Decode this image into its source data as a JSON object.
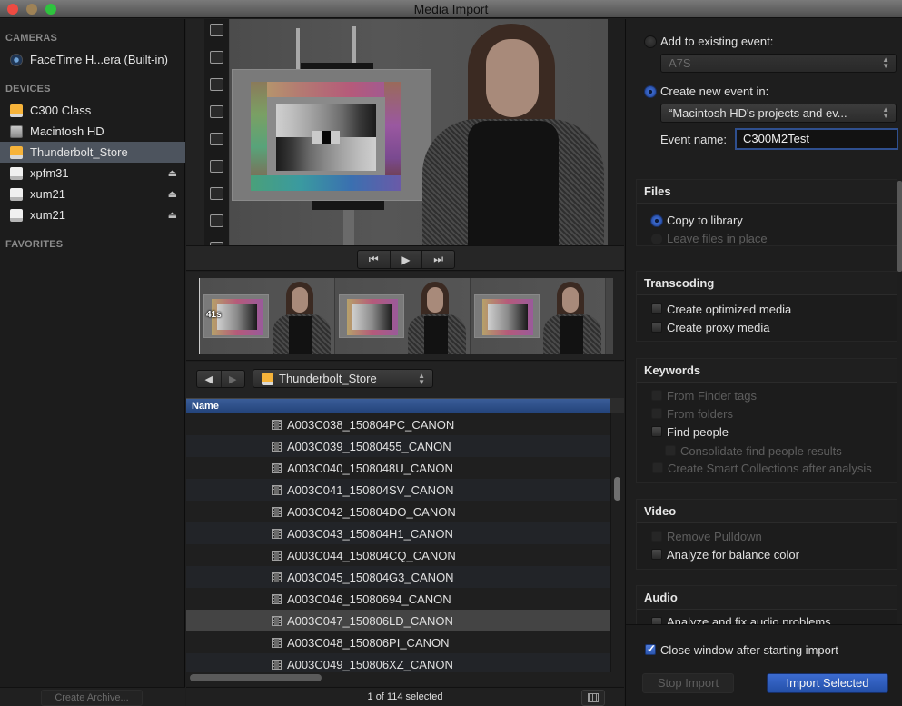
{
  "window": {
    "title": "Media Import"
  },
  "sidebar": {
    "sections": {
      "cameras": "CAMERAS",
      "devices": "DEVICES",
      "favorites": "FAVORITES"
    },
    "cameras": [
      {
        "label": "FaceTime H...era (Built-in)",
        "icon": "camera-icon"
      }
    ],
    "devices": [
      {
        "label": "C300 Class",
        "icon": "external-drive-orange-icon",
        "eject": false,
        "selected": false
      },
      {
        "label": "Macintosh HD",
        "icon": "internal-drive-icon",
        "eject": false,
        "selected": false
      },
      {
        "label": "Thunderbolt_Store",
        "icon": "external-drive-orange-icon",
        "eject": false,
        "selected": true
      },
      {
        "label": "xpfm31",
        "icon": "removable-drive-icon",
        "eject": true,
        "selected": false
      },
      {
        "label": "xum21",
        "icon": "removable-drive-icon",
        "eject": true,
        "selected": false
      },
      {
        "label": "xum21",
        "icon": "removable-drive-icon",
        "eject": true,
        "selected": false
      }
    ],
    "eject_glyph": "⏏",
    "create_archive_label": "Create Archive..."
  },
  "viewer": {
    "transport": {
      "prev_glyph": "⏮",
      "play_glyph": "▶",
      "next_glyph": "⏭"
    },
    "filmstrip_duration": "41s"
  },
  "browser": {
    "back_glyph": "◀",
    "forward_glyph": "▶",
    "location": "Thunderbolt_Store",
    "column_header": "Name",
    "files": [
      {
        "name": "A003C038_150804PC_CANON",
        "selected": false
      },
      {
        "name": "A003C039_15080455_CANON",
        "selected": false
      },
      {
        "name": "A003C040_1508048U_CANON",
        "selected": false
      },
      {
        "name": "A003C041_150804SV_CANON",
        "selected": false
      },
      {
        "name": "A003C042_150804DO_CANON",
        "selected": false
      },
      {
        "name": "A003C043_150804H1_CANON",
        "selected": false
      },
      {
        "name": "A003C044_150804CQ_CANON",
        "selected": false
      },
      {
        "name": "A003C045_150804G3_CANON",
        "selected": false
      },
      {
        "name": "A003C046_15080694_CANON",
        "selected": false
      },
      {
        "name": "A003C047_150806LD_CANON",
        "selected": true
      },
      {
        "name": "A003C048_150806PI_CANON",
        "selected": false
      },
      {
        "name": "A003C049_150806XZ_CANON",
        "selected": false
      }
    ],
    "status": "1 of 114 selected"
  },
  "options": {
    "add_to_existing_label": "Add to existing event:",
    "add_to_existing_selected": false,
    "existing_event_value": "A7S",
    "create_new_label": "Create new event in:",
    "create_new_selected": true,
    "library_value": "“Macintosh HD's projects and ev...",
    "event_name_label": "Event name:",
    "event_name_value": "C300M2Test",
    "files": {
      "header": "Files",
      "copy_label": "Copy to library",
      "copy_selected": true,
      "leave_label": "Leave files in place",
      "leave_enabled": false
    },
    "transcoding": {
      "header": "Transcoding",
      "optimized_label": "Create optimized media",
      "optimized_checked": false,
      "proxy_label": "Create proxy media",
      "proxy_checked": false
    },
    "keywords": {
      "header": "Keywords",
      "finder_tags_label": "From Finder tags",
      "folders_label": "From folders",
      "find_people_label": "Find people",
      "consolidate_label": "Consolidate find people results",
      "smart_collections_label": "Create Smart Collections after analysis"
    },
    "video": {
      "header": "Video",
      "pulldown_label": "Remove Pulldown",
      "balance_label": "Analyze for balance color"
    },
    "audio": {
      "header": "Audio",
      "fix_audio_label": "Analyze and fix audio problems"
    },
    "close_window_label": "Close window after starting import",
    "close_window_checked": true,
    "stop_import_label": "Stop Import",
    "import_selected_label": "Import Selected",
    "accent_color": "#2f5cc0"
  }
}
